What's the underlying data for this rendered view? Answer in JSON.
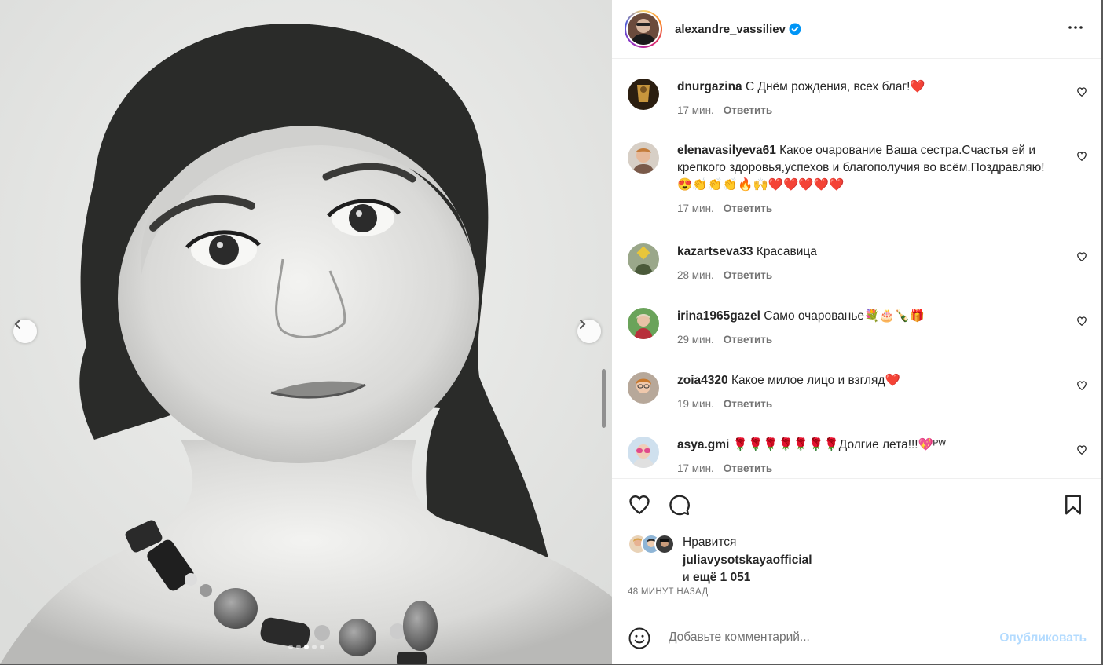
{
  "post": {
    "username": "alexandre_vassiliev",
    "verified": true,
    "carousel": {
      "slide_count": 5,
      "active_slide": 3
    }
  },
  "comments": [
    {
      "user": "dnurgazina",
      "text": "С Днём рождения, всех благ!❤️",
      "time": "17 мин.",
      "reply": "Ответить"
    },
    {
      "user": "elenavasilyeva61",
      "text": "Какое очарование Ваша сестра.Счастья ей и крепкого здоровья,успехов и благополучия во всём.Поздравляю!😍👏👏👏🔥🙌❤️❤️❤️❤️❤️",
      "time": "17 мин.",
      "reply": "Ответить"
    },
    {
      "user": "kazartseva33",
      "text": "Красавица",
      "time": "28 мин.",
      "reply": "Ответить"
    },
    {
      "user": "irina1965gazel",
      "text": "Само очарованье💐🎂🍾🎁",
      "time": "29 мин.",
      "reply": "Ответить"
    },
    {
      "user": "zoia4320",
      "text": "Какое милое лицо и взгляд❤️",
      "time": "19 мин.",
      "reply": "Ответить"
    },
    {
      "user": "asya.gmi",
      "text": "🌹🌹🌹🌹🌹🌹🌹Долгие лета!!!💖ᴾᵂ",
      "time": "17 мин.",
      "reply": "Ответить"
    }
  ],
  "likes": {
    "prefix": "Нравится",
    "user": "juliavysotskayaofficial",
    "and": "и",
    "more": "ещё 1 051"
  },
  "timestamp": "48 МИНУТ НАЗАД",
  "add_comment": {
    "placeholder": "Добавьте комментарий...",
    "publish": "Опубликовать"
  },
  "icons": {
    "like": "heart-icon",
    "comment": "comment-icon",
    "save": "bookmark-icon",
    "more": "more-icon",
    "emoji": "emoji-icon",
    "prev": "chevron-left-icon",
    "next": "chevron-right-icon"
  },
  "colors": {
    "accent": "#0095f6",
    "publish_disabled": "#b3dbff",
    "like_red": "#e0245e"
  }
}
